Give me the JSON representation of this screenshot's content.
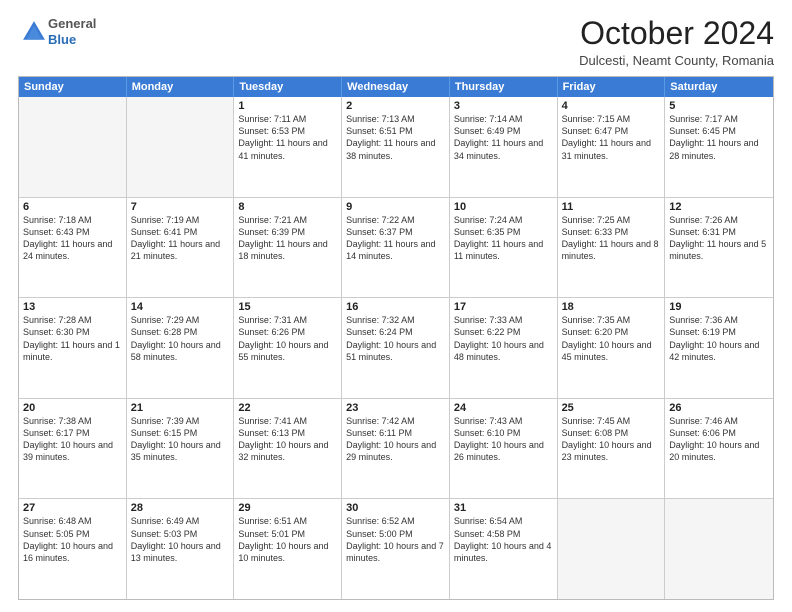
{
  "header": {
    "logo": {
      "general": "General",
      "blue": "Blue"
    },
    "title": "October 2024",
    "location": "Dulcesti, Neamt County, Romania"
  },
  "days_of_week": [
    "Sunday",
    "Monday",
    "Tuesday",
    "Wednesday",
    "Thursday",
    "Friday",
    "Saturday"
  ],
  "weeks": [
    [
      {
        "day": "",
        "empty": true
      },
      {
        "day": "",
        "empty": true
      },
      {
        "day": "1",
        "sunrise": "Sunrise: 7:11 AM",
        "sunset": "Sunset: 6:53 PM",
        "daylight": "Daylight: 11 hours and 41 minutes."
      },
      {
        "day": "2",
        "sunrise": "Sunrise: 7:13 AM",
        "sunset": "Sunset: 6:51 PM",
        "daylight": "Daylight: 11 hours and 38 minutes."
      },
      {
        "day": "3",
        "sunrise": "Sunrise: 7:14 AM",
        "sunset": "Sunset: 6:49 PM",
        "daylight": "Daylight: 11 hours and 34 minutes."
      },
      {
        "day": "4",
        "sunrise": "Sunrise: 7:15 AM",
        "sunset": "Sunset: 6:47 PM",
        "daylight": "Daylight: 11 hours and 31 minutes."
      },
      {
        "day": "5",
        "sunrise": "Sunrise: 7:17 AM",
        "sunset": "Sunset: 6:45 PM",
        "daylight": "Daylight: 11 hours and 28 minutes."
      }
    ],
    [
      {
        "day": "6",
        "sunrise": "Sunrise: 7:18 AM",
        "sunset": "Sunset: 6:43 PM",
        "daylight": "Daylight: 11 hours and 24 minutes."
      },
      {
        "day": "7",
        "sunrise": "Sunrise: 7:19 AM",
        "sunset": "Sunset: 6:41 PM",
        "daylight": "Daylight: 11 hours and 21 minutes."
      },
      {
        "day": "8",
        "sunrise": "Sunrise: 7:21 AM",
        "sunset": "Sunset: 6:39 PM",
        "daylight": "Daylight: 11 hours and 18 minutes."
      },
      {
        "day": "9",
        "sunrise": "Sunrise: 7:22 AM",
        "sunset": "Sunset: 6:37 PM",
        "daylight": "Daylight: 11 hours and 14 minutes."
      },
      {
        "day": "10",
        "sunrise": "Sunrise: 7:24 AM",
        "sunset": "Sunset: 6:35 PM",
        "daylight": "Daylight: 11 hours and 11 minutes."
      },
      {
        "day": "11",
        "sunrise": "Sunrise: 7:25 AM",
        "sunset": "Sunset: 6:33 PM",
        "daylight": "Daylight: 11 hours and 8 minutes."
      },
      {
        "day": "12",
        "sunrise": "Sunrise: 7:26 AM",
        "sunset": "Sunset: 6:31 PM",
        "daylight": "Daylight: 11 hours and 5 minutes."
      }
    ],
    [
      {
        "day": "13",
        "sunrise": "Sunrise: 7:28 AM",
        "sunset": "Sunset: 6:30 PM",
        "daylight": "Daylight: 11 hours and 1 minute."
      },
      {
        "day": "14",
        "sunrise": "Sunrise: 7:29 AM",
        "sunset": "Sunset: 6:28 PM",
        "daylight": "Daylight: 10 hours and 58 minutes."
      },
      {
        "day": "15",
        "sunrise": "Sunrise: 7:31 AM",
        "sunset": "Sunset: 6:26 PM",
        "daylight": "Daylight: 10 hours and 55 minutes."
      },
      {
        "day": "16",
        "sunrise": "Sunrise: 7:32 AM",
        "sunset": "Sunset: 6:24 PM",
        "daylight": "Daylight: 10 hours and 51 minutes."
      },
      {
        "day": "17",
        "sunrise": "Sunrise: 7:33 AM",
        "sunset": "Sunset: 6:22 PM",
        "daylight": "Daylight: 10 hours and 48 minutes."
      },
      {
        "day": "18",
        "sunrise": "Sunrise: 7:35 AM",
        "sunset": "Sunset: 6:20 PM",
        "daylight": "Daylight: 10 hours and 45 minutes."
      },
      {
        "day": "19",
        "sunrise": "Sunrise: 7:36 AM",
        "sunset": "Sunset: 6:19 PM",
        "daylight": "Daylight: 10 hours and 42 minutes."
      }
    ],
    [
      {
        "day": "20",
        "sunrise": "Sunrise: 7:38 AM",
        "sunset": "Sunset: 6:17 PM",
        "daylight": "Daylight: 10 hours and 39 minutes."
      },
      {
        "day": "21",
        "sunrise": "Sunrise: 7:39 AM",
        "sunset": "Sunset: 6:15 PM",
        "daylight": "Daylight: 10 hours and 35 minutes."
      },
      {
        "day": "22",
        "sunrise": "Sunrise: 7:41 AM",
        "sunset": "Sunset: 6:13 PM",
        "daylight": "Daylight: 10 hours and 32 minutes."
      },
      {
        "day": "23",
        "sunrise": "Sunrise: 7:42 AM",
        "sunset": "Sunset: 6:11 PM",
        "daylight": "Daylight: 10 hours and 29 minutes."
      },
      {
        "day": "24",
        "sunrise": "Sunrise: 7:43 AM",
        "sunset": "Sunset: 6:10 PM",
        "daylight": "Daylight: 10 hours and 26 minutes."
      },
      {
        "day": "25",
        "sunrise": "Sunrise: 7:45 AM",
        "sunset": "Sunset: 6:08 PM",
        "daylight": "Daylight: 10 hours and 23 minutes."
      },
      {
        "day": "26",
        "sunrise": "Sunrise: 7:46 AM",
        "sunset": "Sunset: 6:06 PM",
        "daylight": "Daylight: 10 hours and 20 minutes."
      }
    ],
    [
      {
        "day": "27",
        "sunrise": "Sunrise: 6:48 AM",
        "sunset": "Sunset: 5:05 PM",
        "daylight": "Daylight: 10 hours and 16 minutes."
      },
      {
        "day": "28",
        "sunrise": "Sunrise: 6:49 AM",
        "sunset": "Sunset: 5:03 PM",
        "daylight": "Daylight: 10 hours and 13 minutes."
      },
      {
        "day": "29",
        "sunrise": "Sunrise: 6:51 AM",
        "sunset": "Sunset: 5:01 PM",
        "daylight": "Daylight: 10 hours and 10 minutes."
      },
      {
        "day": "30",
        "sunrise": "Sunrise: 6:52 AM",
        "sunset": "Sunset: 5:00 PM",
        "daylight": "Daylight: 10 hours and 7 minutes."
      },
      {
        "day": "31",
        "sunrise": "Sunrise: 6:54 AM",
        "sunset": "Sunset: 4:58 PM",
        "daylight": "Daylight: 10 hours and 4 minutes."
      },
      {
        "day": "",
        "empty": true
      },
      {
        "day": "",
        "empty": true
      }
    ]
  ]
}
